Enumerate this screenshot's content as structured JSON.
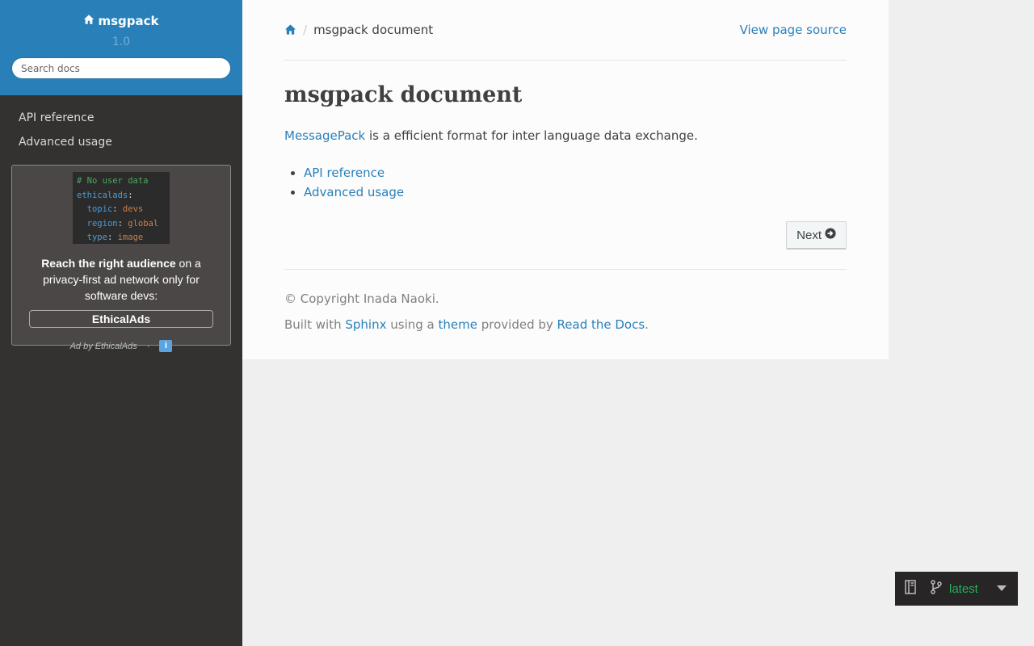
{
  "sidebar": {
    "project_name": "msgpack",
    "version": "1.0",
    "search_placeholder": "Search docs",
    "nav_items": [
      {
        "label": "API reference"
      },
      {
        "label": "Advanced usage"
      }
    ]
  },
  "ad": {
    "code_lines": [
      {
        "comment": "# No user data"
      },
      {
        "key": "ethicalads",
        "punct": ":"
      },
      {
        "key": "topic",
        "punct": ": ",
        "val": "devs"
      },
      {
        "key": "region",
        "punct": ": ",
        "val": "global"
      },
      {
        "key": "type",
        "punct": ": ",
        "val": "image"
      }
    ],
    "text_bold": "Reach the right audience",
    "text_rest": " on a privacy-first ad network only for software devs:",
    "cta": "EthicalAds",
    "footer_text": "Ad by EthicalAds",
    "footer_sep": "·",
    "info_glyph": "i"
  },
  "breadcrumbs": {
    "separator": "/",
    "current": "msgpack document",
    "view_source": "View page source"
  },
  "content": {
    "title": "msgpack document",
    "intro_link": "MessagePack",
    "intro_rest": " is a efficient format for inter language data exchange.",
    "toc": [
      {
        "label": "API reference"
      },
      {
        "label": "Advanced usage"
      }
    ],
    "next_label": "Next"
  },
  "footer": {
    "copyright": "© Copyright Inada Naoki.",
    "built_prefix": "Built with ",
    "sphinx": "Sphinx",
    "using": " using a ",
    "theme": "theme",
    "provided": " provided by ",
    "rtd": "Read the Docs",
    "period": "."
  },
  "rtd_badge": {
    "version": "latest"
  },
  "colors": {
    "header_blue": "#2980b9",
    "sidebar_dark": "#343131",
    "link": "#2980b9",
    "badge_green": "#27ae60"
  }
}
